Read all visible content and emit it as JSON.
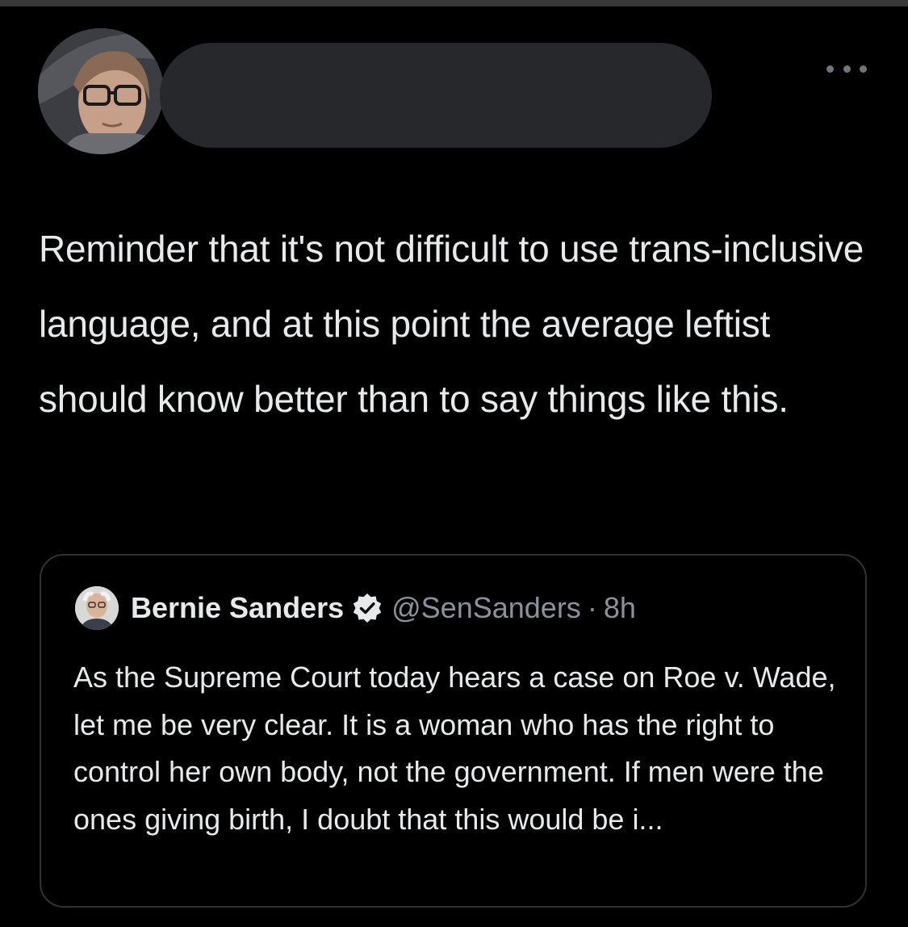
{
  "tweet": {
    "avatar_icon": "user-avatar-photo",
    "more_icon": "more-options-icon",
    "text": "Reminder that it's not difficult to use trans-inclusive language, and at this point the average leftist should know better than to say things like this."
  },
  "quoted_tweet": {
    "author_name": "Bernie Sanders",
    "verified_icon": "verified-badge-icon",
    "handle": "@SenSanders",
    "separator": "·",
    "time": "8h",
    "text": "As the Supreme Court today hears a case on Roe v. Wade, let me be very clear. It is a woman who has the right to control her own body, not the government. If men were the ones giving birth, I doubt that this would be i..."
  },
  "colors": {
    "background": "#000000",
    "text_primary": "#e7e9ea",
    "text_secondary": "#8b9299",
    "card_border": "#2f3336",
    "redaction": "#26282c"
  }
}
